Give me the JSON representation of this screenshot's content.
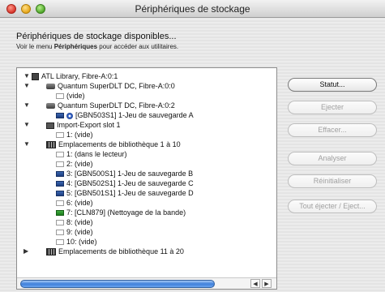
{
  "window": {
    "title": "Périphériques de stockage"
  },
  "header": {
    "heading": "Périphériques de stockage disponibles...",
    "sub_prefix": "Voir le menu ",
    "sub_bold": "Périphériques",
    "sub_suffix": " pour accéder aux utilitaires."
  },
  "tree": {
    "rows": [
      {
        "label": "ATL Library, Fibre-A:0:1"
      },
      {
        "label": "Quantum SuperDLT DC, Fibre-A:0:0"
      },
      {
        "label": "(vide)"
      },
      {
        "label": "Quantum SuperDLT DC, Fibre-A:0:2"
      },
      {
        "label": "[GBN503S1] 1-Jeu de sauvegarde A"
      },
      {
        "label": "Import-Export slot 1"
      },
      {
        "label": "1: (vide)"
      },
      {
        "label": "Emplacements de bibliothèque 1 à 10"
      },
      {
        "label": "1: (dans le lecteur)"
      },
      {
        "label": "2: (vide)"
      },
      {
        "label": "3: [GBN500S1] 1-Jeu de sauvegarde B"
      },
      {
        "label": "4: [GBN502S1] 1-Jeu de sauvegarde C"
      },
      {
        "label": "5: [GBN501S1] 1-Jeu de sauvegarde D"
      },
      {
        "label": "6: (vide)"
      },
      {
        "label": "7: [CLN879] (Nettoyage de la bande)"
      },
      {
        "label": "8: (vide)"
      },
      {
        "label": "9: (vide)"
      },
      {
        "label": "10: (vide)"
      },
      {
        "label": "Emplacements de bibliothèque 11 à 20"
      }
    ]
  },
  "buttons": {
    "statut": "Statut...",
    "ejecter": "Ejecter",
    "effacer": "Effacer...",
    "analyser": "Analyser",
    "reinitialiser": "Réinitialiser",
    "tout_ejecter": "Tout éjecter / Eject..."
  }
}
